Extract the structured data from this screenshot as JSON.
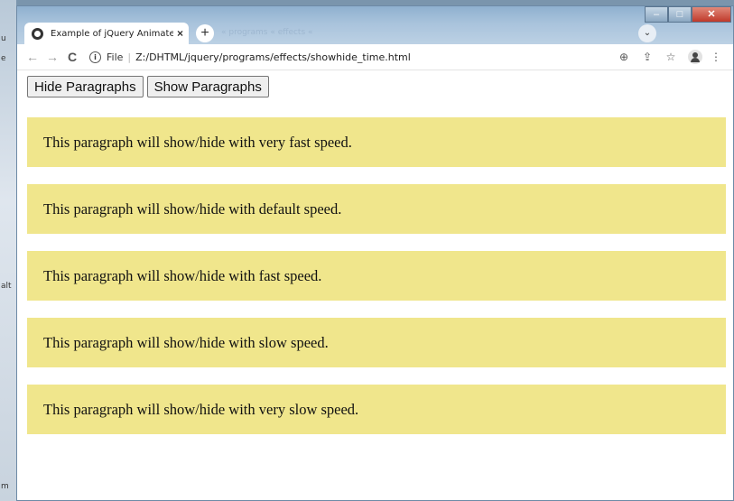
{
  "desktop": {
    "edge_letters": [
      "u",
      "e",
      "alt",
      "m"
    ]
  },
  "browser": {
    "tab": {
      "title": "Example of jQuery Animated Sho",
      "close": "×"
    },
    "new_tab": "+",
    "ghost_text": "« programs « effects «",
    "tab_search": "⌄",
    "window_controls": {
      "minimize": "–",
      "maximize": "□",
      "close": "✕"
    },
    "nav": {
      "back": "←",
      "forward": "→",
      "reload": "C"
    },
    "address": {
      "scheme_label": "File",
      "separator": "|",
      "url": "Z:/DHTML/jquery/programs/effects/showhide_time.html"
    },
    "toolbar_icons": {
      "zoom": "⊕",
      "share": "⇪",
      "bookmark": "☆",
      "menu": "⋮"
    }
  },
  "page": {
    "buttons": {
      "hide": "Hide Paragraphs",
      "show": "Show Paragraphs"
    },
    "paragraphs": [
      "This paragraph will show/hide with very fast speed.",
      "This paragraph will show/hide with default speed.",
      "This paragraph will show/hide with fast speed.",
      "This paragraph will show/hide with slow speed.",
      "This paragraph will show/hide with very slow speed."
    ],
    "paragraph_background": "#f0e68c"
  }
}
